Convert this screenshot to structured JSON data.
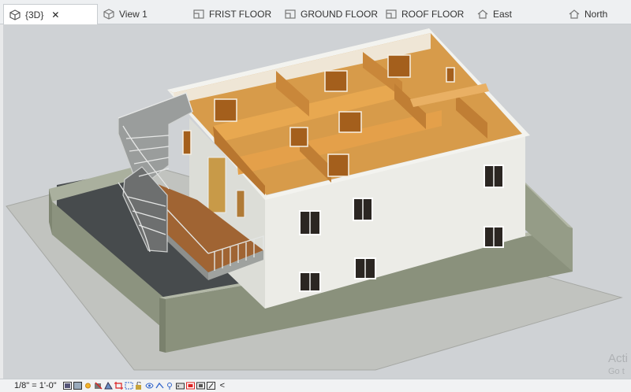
{
  "tabs": [
    {
      "label": "{3D}",
      "icon": "cube-icon",
      "active": true,
      "closable": true
    },
    {
      "label": "View 1",
      "icon": "cube-icon"
    },
    {
      "label": "FRIST FLOOR",
      "icon": "floor-plan-icon"
    },
    {
      "label": "GROUND FLOOR",
      "icon": "floor-plan-icon"
    },
    {
      "label": "ROOF FLOOR",
      "icon": "floor-plan-icon"
    },
    {
      "label": "East",
      "icon": "elevation-icon"
    },
    {
      "label": "North",
      "icon": "elevation-icon"
    }
  ],
  "status": {
    "scale": "1/8\" = 1'-0\"",
    "collapse_label": "<"
  },
  "watermark": {
    "line1": "Acti",
    "line2": "Go t"
  },
  "colors": {
    "wall": "#e9eae5",
    "floor_wood": "#d99a45",
    "boundary_wall": "#8f9683",
    "ground": "#c2c4c0",
    "background": "#cfd2d5"
  }
}
